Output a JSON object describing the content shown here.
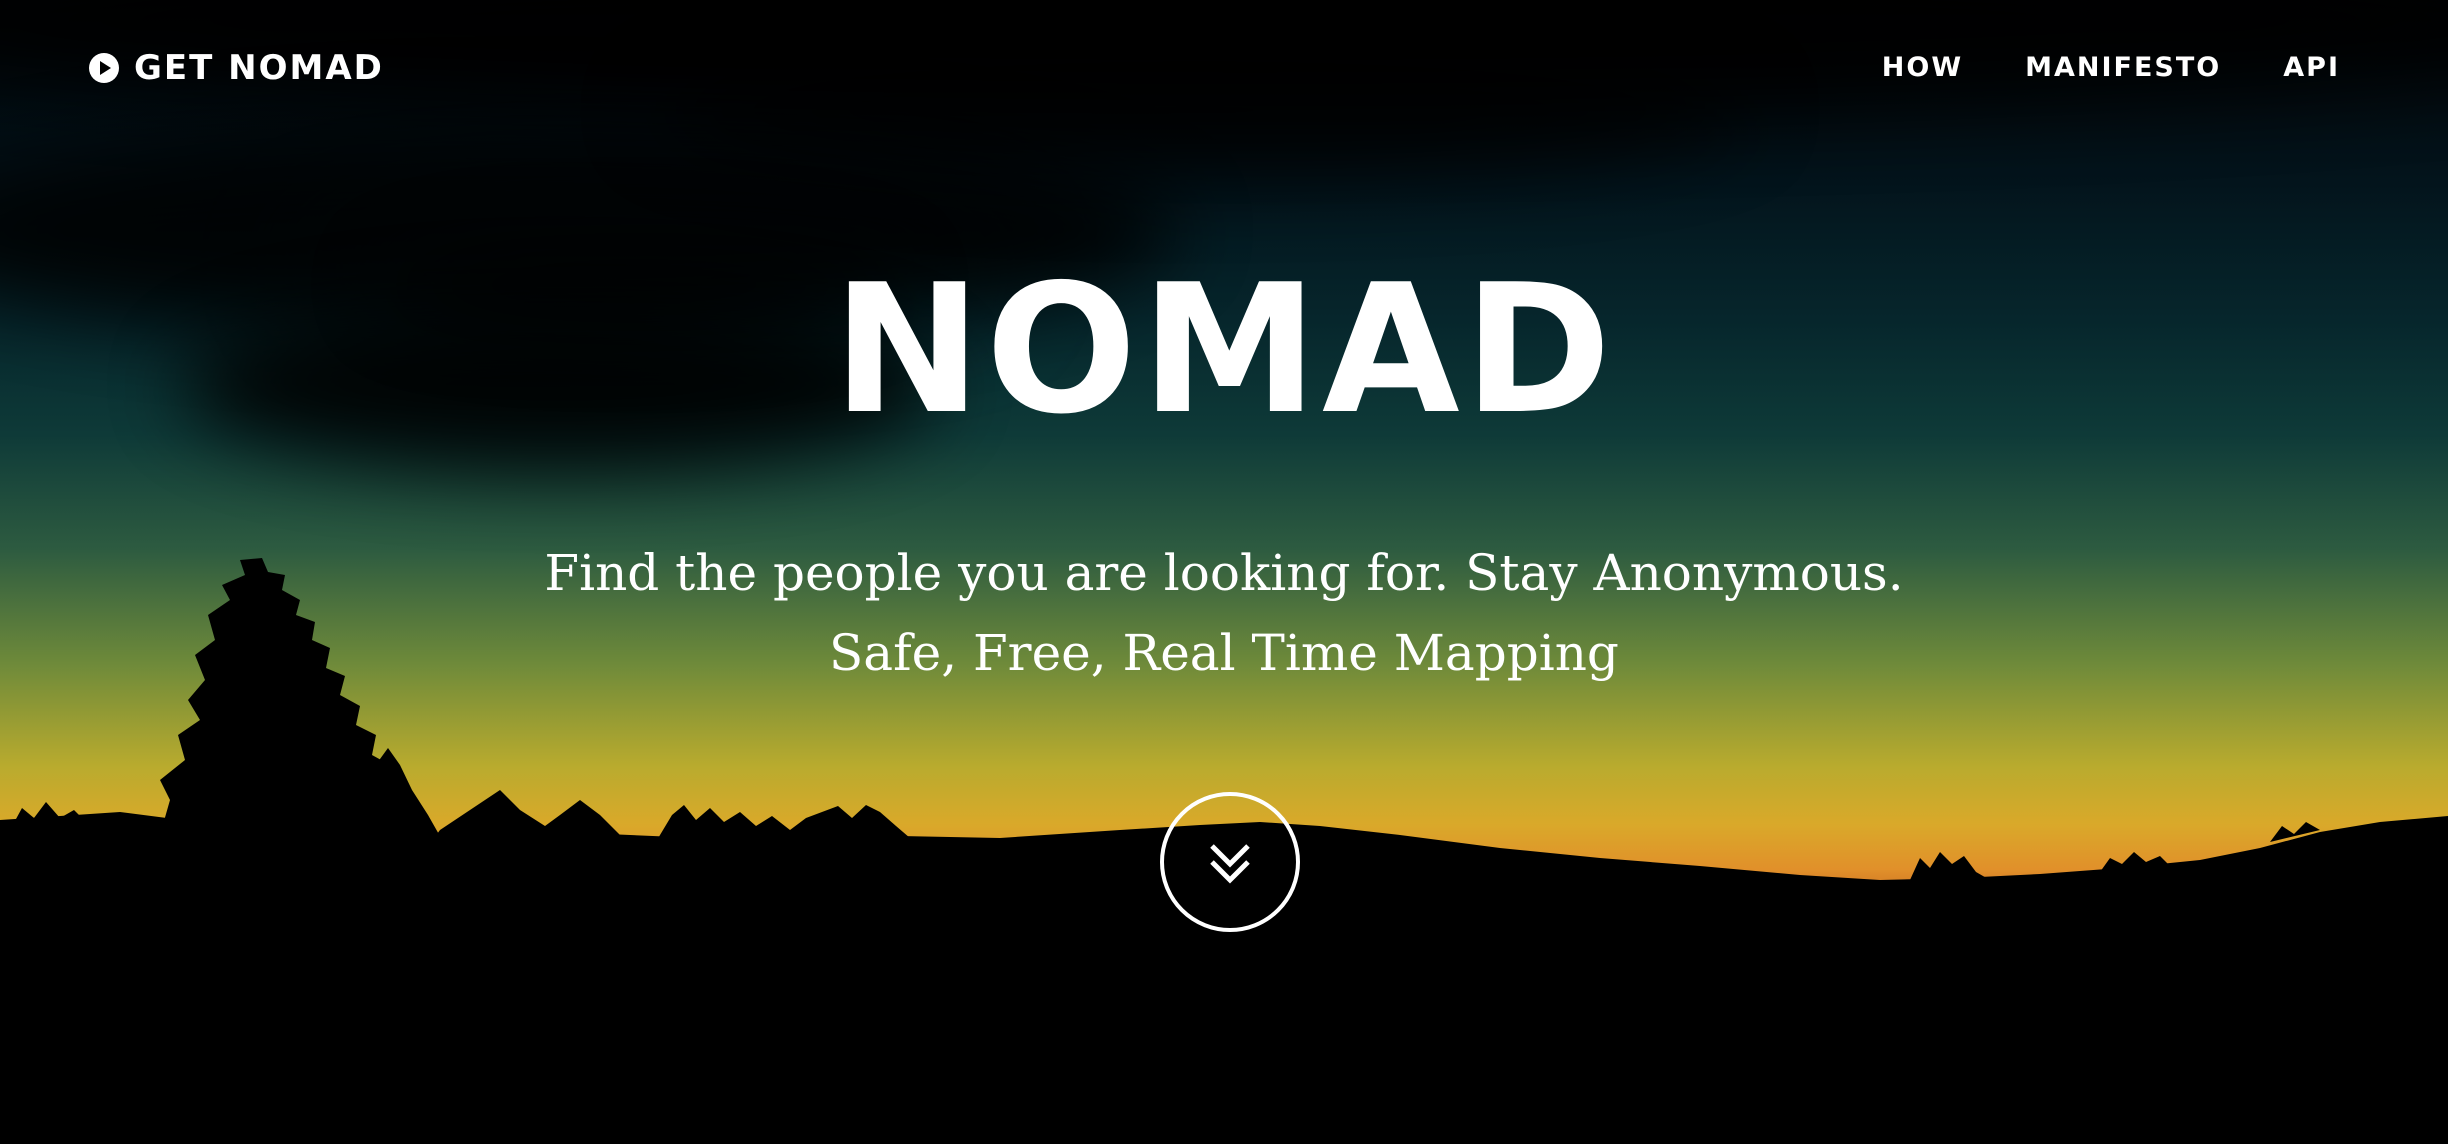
{
  "header": {
    "brand_label": "GET NOMAD",
    "brand_icon": "play-circle-icon",
    "nav_items": [
      {
        "label": "HOW"
      },
      {
        "label": "MANIFESTO"
      },
      {
        "label": "API"
      }
    ]
  },
  "hero": {
    "title": "NOMAD",
    "tagline": "Find the people you are looking for. Stay Anonymous. Safe, Free, Real Time Mapping",
    "scroll_icon": "double-chevron-down-icon"
  },
  "colors": {
    "text": "#ffffff",
    "sky_top": "#020508",
    "sky_mid": "#0e3a38",
    "sky_horizon": "#d9a92a",
    "horizon_orange": "#e1902a",
    "ground": "#000000"
  }
}
